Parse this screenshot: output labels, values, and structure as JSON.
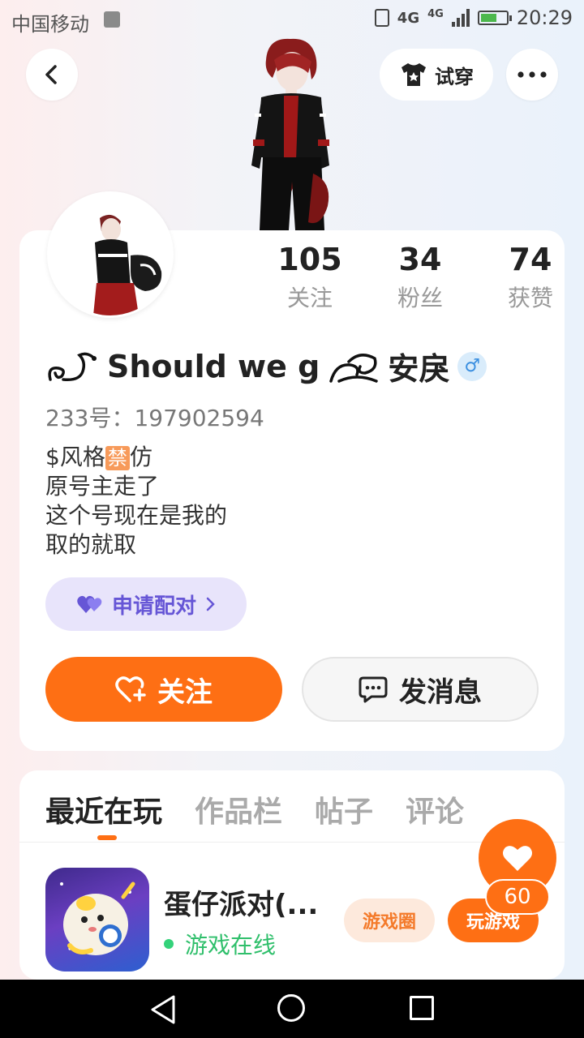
{
  "status_bar": {
    "carrier": "中国移动",
    "network_1": "4G",
    "network_2": "4G",
    "time": "20:29"
  },
  "header": {
    "try_on_label": "试穿"
  },
  "profile": {
    "stats": [
      {
        "value": "105",
        "label": "关注"
      },
      {
        "value": "34",
        "label": "粉丝"
      },
      {
        "value": "74",
        "label": "获赞"
      }
    ],
    "name": "Should we g",
    "name_suffix": "安戾",
    "gender_symbol": "♂",
    "uid": "233号：197902594",
    "bio": {
      "line1_prefix": "$风格",
      "line1_badge": "禁",
      "line1_suffix": "仿",
      "line2": "原号主走了",
      "line3": "这个号现在是我的",
      "line4": "取的就取"
    },
    "pair_label": "申请配对",
    "follow_label": "关注",
    "message_label": "发消息"
  },
  "tabs": [
    "最近在玩",
    "作品栏",
    "帖子",
    "评论"
  ],
  "game": {
    "title": "蛋仔派对(...",
    "status": "游戏在线",
    "circle_label": "游戏圈",
    "play_label": "玩游戏"
  },
  "likes": {
    "count": "60"
  },
  "colors": {
    "accent": "#fe6f14",
    "pair_purple": "#6656d6",
    "online_green": "#2fbf6b"
  }
}
